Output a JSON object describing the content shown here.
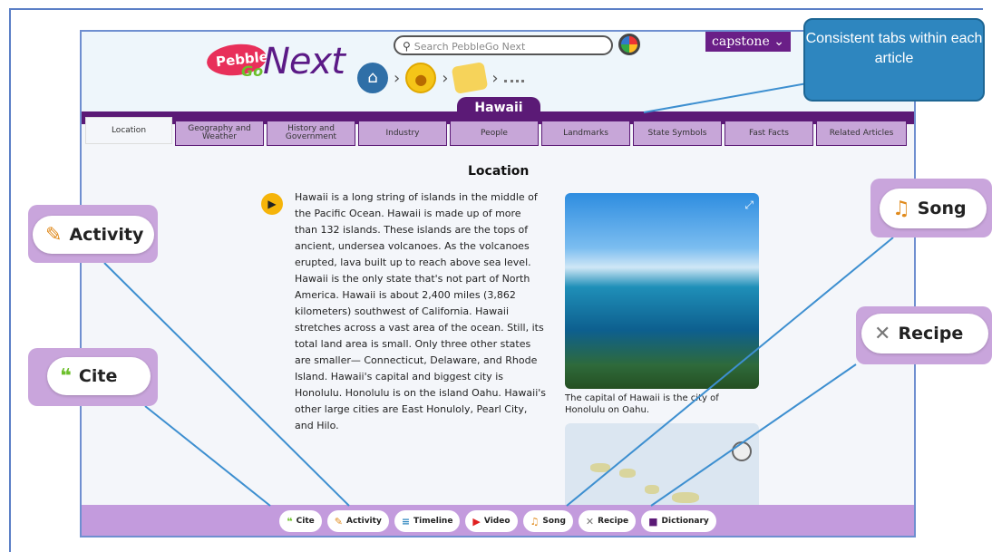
{
  "header": {
    "logo_pebble": "Pebble",
    "logo_go": "Go",
    "logo_next": "Next",
    "search_placeholder": "Search PebbleGo Next",
    "capstone": "capstone",
    "article_title": "Hawaii"
  },
  "tabs": [
    "Location",
    "Geography and Weather",
    "History and Government",
    "Industry",
    "People",
    "Landmarks",
    "State Symbols",
    "Fast Facts",
    "Related Articles"
  ],
  "content": {
    "heading": "Location",
    "body": "Hawaii is a long string of islands in the middle of the Pacific Ocean. Hawaii is made up of more than 132 islands. These islands are the tops of ancient, undersea volcanoes. As the volcanoes erupted, lava built up to reach above sea level. Hawaii is the only state that's not part of North America. Hawaii is about 2,400 miles (3,862 kilometers) southwest of California. Hawaii stretches across a vast area of the ocean. Still, its total land area is small. Only three other states are smaller— Connecticut, Delaware, and Rhode Island. Hawaii's capital and biggest city is Honolulu. Honolulu is on the island Oahu. Hawaii's other large cities are East Honuloly, Pearl City, and Hilo.",
    "photo_caption": "The capital of Hawaii is the city of Honolulu on Oahu."
  },
  "toolbar": [
    "Cite",
    "Activity",
    "Timeline",
    "Video",
    "Song",
    "Recipe",
    "Dictionary"
  ],
  "callouts": {
    "activity": "Activity",
    "cite": "Cite",
    "song": "Song",
    "recipe": "Recipe",
    "note": "Consistent tabs within each article"
  },
  "colors": {
    "purple": "#5b1a76",
    "tab_fill": "#c7a6d8",
    "callout": "#c9a5dc",
    "note_blue": "#2e86bf"
  }
}
